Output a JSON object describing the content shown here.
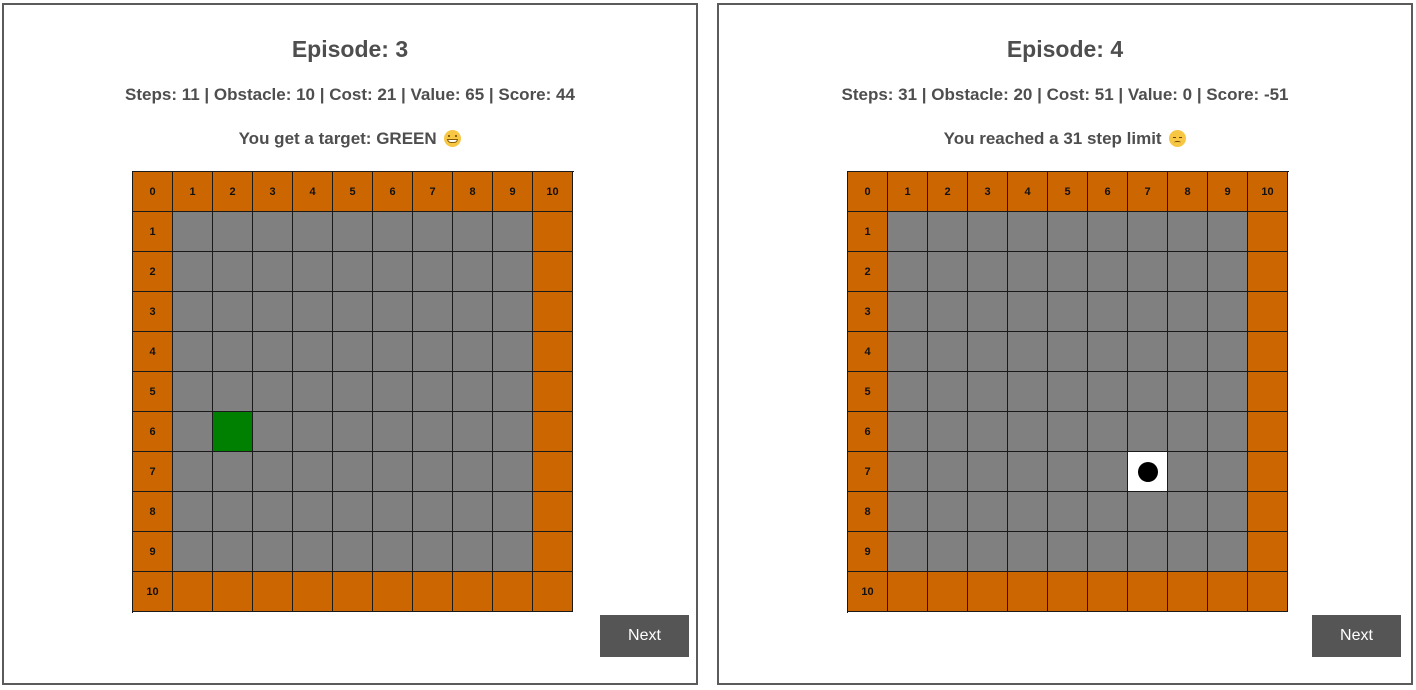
{
  "panels": [
    {
      "title": "Episode: 3",
      "stats": "Steps: 11 | Obstacle: 10 | Cost: 21 | Value: 65 | Score: 44",
      "message": "You get a target: GREEN",
      "emoji": "grinning-face-icon",
      "button_label": "Next",
      "grid": {
        "size": 11,
        "col_labels": [
          "0",
          "1",
          "2",
          "3",
          "4",
          "5",
          "6",
          "7",
          "8",
          "9",
          "10"
        ],
        "row_labels": [
          "0",
          "1",
          "2",
          "3",
          "4",
          "5",
          "6",
          "7",
          "8",
          "9",
          "10"
        ],
        "colors": {
          "wall": "#cc6600",
          "floor": "#808080",
          "target": "#008000"
        },
        "special_cells": [
          {
            "row": 6,
            "col": 2,
            "type": "green"
          }
        ]
      }
    },
    {
      "title": "Episode: 4",
      "stats": "Steps: 31 | Obstacle: 20 | Cost: 51 | Value: 0 | Score: -51",
      "message": "You reached a 31 step limit",
      "emoji": "disappointed-face-icon",
      "button_label": "Next",
      "grid": {
        "size": 11,
        "col_labels": [
          "0",
          "1",
          "2",
          "3",
          "4",
          "5",
          "6",
          "7",
          "8",
          "9",
          "10"
        ],
        "row_labels": [
          "0",
          "1",
          "2",
          "3",
          "4",
          "5",
          "6",
          "7",
          "8",
          "9",
          "10"
        ],
        "colors": {
          "wall": "#cc6600",
          "floor": "#808080",
          "agent_cell": "#ffffff",
          "agent": "#000000"
        },
        "special_cells": [
          {
            "row": 7,
            "col": 7,
            "type": "agent"
          }
        ]
      }
    }
  ]
}
